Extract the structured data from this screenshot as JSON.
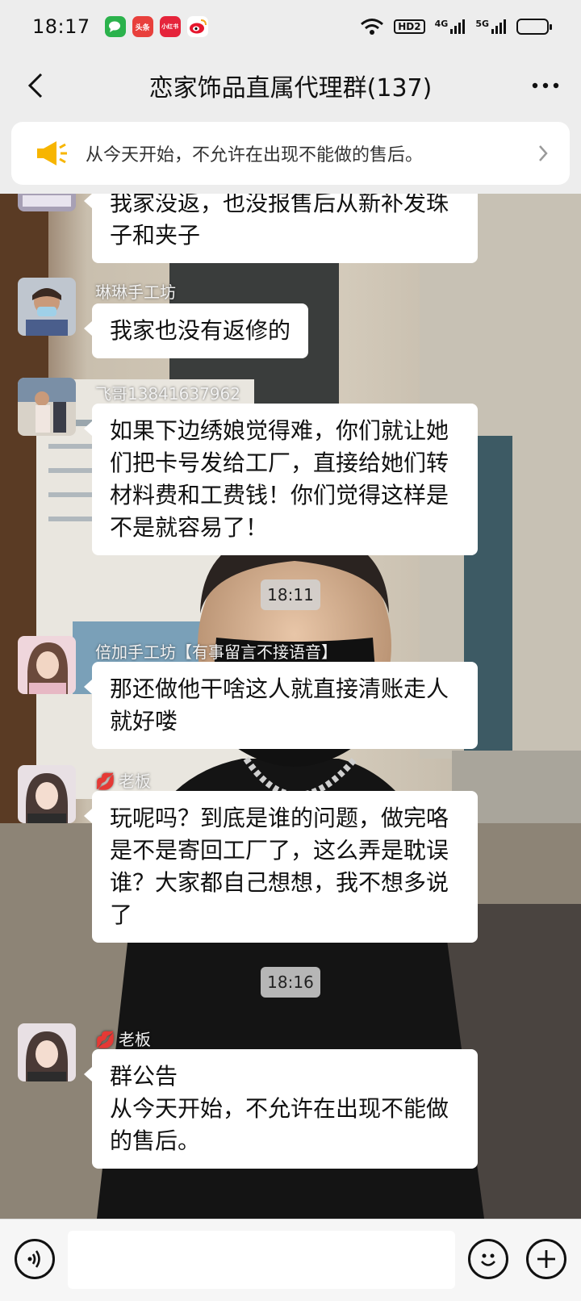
{
  "status_bar": {
    "time": "18:17",
    "apps": [
      {
        "icon": "wechat-app-icon",
        "label": "",
        "color": "#2bb24c"
      },
      {
        "icon": "toutiao-app-icon",
        "label": "头条",
        "color": "#e8403c"
      },
      {
        "icon": "xiaohongshu-app-icon",
        "label": "小红书",
        "color": "#e5243b"
      },
      {
        "icon": "weibo-app-icon",
        "label": "",
        "color": "#f5a623"
      }
    ],
    "hd_label": "HD2",
    "net1": "4G",
    "net2": "5G",
    "battery_level": 0.6
  },
  "header": {
    "title": "恋家饰品直属代理群(137)"
  },
  "notice": {
    "text": "从今天开始，不允许在出现不能做的售后。",
    "accent_color": "#f7b500"
  },
  "messages": [
    {
      "lines": [
        "我家没返，也没报售后从新补发珠",
        "子和夹子"
      ]
    },
    {
      "sender": "琳琳手工坊",
      "lines": [
        "我家也没有返修的"
      ]
    },
    {
      "sender": "飞哥13841637962",
      "lines": [
        "如果下边绣娘觉得难，你们就让她",
        "们把卡号发给工厂，直接给她们转",
        "材料费和工费钱！你们觉得这样是",
        "不是就容易了！"
      ]
    },
    {
      "sender": "倍加手工坊【有事留言不接语音】",
      "lines": [
        "那还做他干啥这人就直接清账走人",
        "就好喽"
      ]
    },
    {
      "sender": "老板",
      "lines": [
        "玩呢吗？到底是谁的问题，做完咯",
        "是不是寄回工厂了，这么弄是耽误",
        "谁？大家都自己想想，我不想多说",
        "了"
      ]
    },
    {
      "sender": "老板",
      "lines": [
        "群公告",
        "从今天开始，不允许在出现不能做",
        "的售后。"
      ]
    }
  ],
  "timestamps": [
    "18:11",
    "18:16"
  ],
  "input": {
    "placeholder": ""
  }
}
